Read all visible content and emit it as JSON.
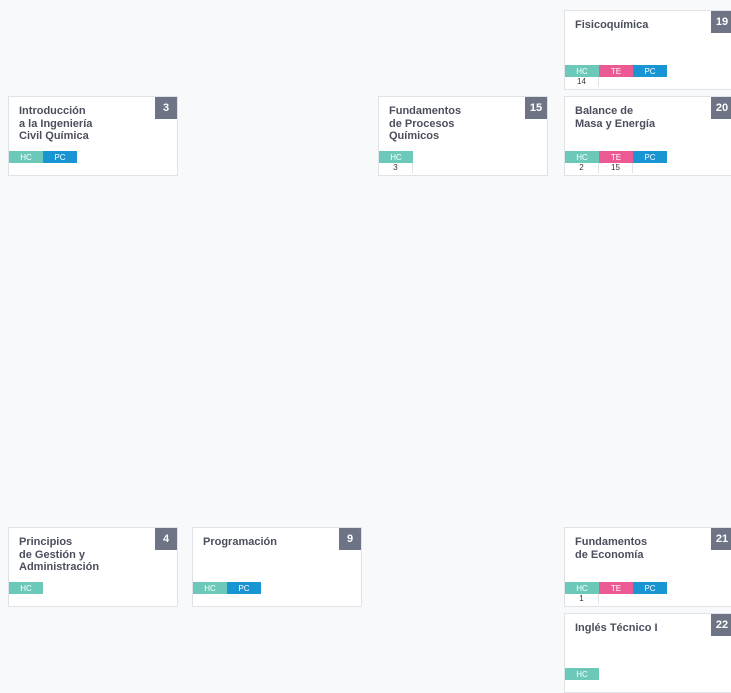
{
  "colors": {
    "HC": "#6cc8b8",
    "TE": "#ec5a93",
    "PC": "#1a95d4"
  },
  "courses": [
    {
      "id": "c3",
      "number": "3",
      "title_lines": [
        "Introducción",
        "a la Ingeniería",
        "Civil Química"
      ],
      "tags": [
        "HC",
        "PC"
      ],
      "prereqs": []
    },
    {
      "id": "c15",
      "number": "15",
      "title_lines": [
        "Fundamentos",
        "de Procesos",
        "Químicos"
      ],
      "tags": [
        "HC"
      ],
      "prereqs": [
        "3"
      ]
    },
    {
      "id": "c19",
      "number": "19",
      "title_lines": [
        "Fisicoquímica"
      ],
      "tags": [
        "HC",
        "TE",
        "PC"
      ],
      "prereqs": [
        "14"
      ]
    },
    {
      "id": "c20",
      "number": "20",
      "title_lines": [
        "Balance de",
        "Masa y Energía"
      ],
      "tags": [
        "HC",
        "TE",
        "PC"
      ],
      "prereqs": [
        "2",
        "15"
      ]
    },
    {
      "id": "c4",
      "number": "4",
      "title_lines": [
        "Principios",
        "de Gestión y",
        "Administración"
      ],
      "tags": [
        "HC"
      ],
      "prereqs": []
    },
    {
      "id": "c9",
      "number": "9",
      "title_lines": [
        "Programación"
      ],
      "tags": [
        "HC",
        "PC"
      ],
      "prereqs": []
    },
    {
      "id": "c21",
      "number": "21",
      "title_lines": [
        "Fundamentos",
        "de Economía"
      ],
      "tags": [
        "HC",
        "TE",
        "PC"
      ],
      "prereqs": [
        "1"
      ]
    },
    {
      "id": "c22",
      "number": "22",
      "title_lines": [
        "Inglés Técnico I"
      ],
      "tags": [
        "HC"
      ],
      "prereqs": []
    }
  ]
}
